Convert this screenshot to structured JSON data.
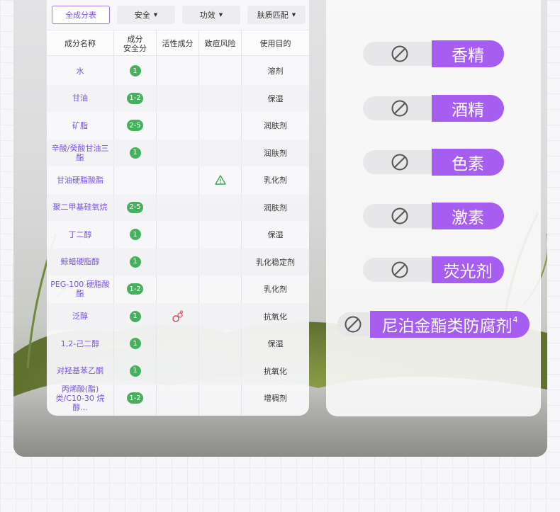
{
  "filters": [
    {
      "label": "全成分表",
      "active": true
    },
    {
      "label": "安全",
      "active": false
    },
    {
      "label": "功效",
      "active": false
    },
    {
      "label": "肤质匹配",
      "active": false
    }
  ],
  "table": {
    "headers": {
      "name": "成分名称",
      "safety_line1": "成分",
      "safety_line2": "安全分",
      "active": "活性成分",
      "acne": "致痘风险",
      "purpose": "使用目的"
    },
    "rows": [
      {
        "name": "水",
        "score": "1",
        "active": "",
        "acne": "",
        "purpose": "溶剂"
      },
      {
        "name": "甘油",
        "score": "1-2",
        "active": "",
        "acne": "",
        "purpose": "保湿"
      },
      {
        "name": "矿脂",
        "score": "2-5",
        "active": "",
        "acne": "",
        "purpose": "润肤剂"
      },
      {
        "name": "辛酸/癸酸甘油三酯",
        "score": "1",
        "active": "",
        "acne": "",
        "purpose": "润肤剂"
      },
      {
        "name": "甘油硬脂酸酯",
        "score": "",
        "active": "",
        "acne": "warning-icon",
        "purpose": "乳化剂"
      },
      {
        "name": "聚二甲基硅氧烷",
        "score": "2-5",
        "active": "",
        "acne": "",
        "purpose": "润肤剂"
      },
      {
        "name": "丁二醇",
        "score": "1",
        "active": "",
        "acne": "",
        "purpose": "保湿"
      },
      {
        "name": "鲸蜡硬脂醇",
        "score": "1",
        "active": "",
        "acne": "",
        "purpose": "乳化稳定剂"
      },
      {
        "name": "PEG-100 硬脂酸酯",
        "score": "1-2",
        "active": "",
        "acne": "",
        "purpose": "乳化剂"
      },
      {
        "name": "泛醇",
        "score": "1",
        "active": "bubble-icon",
        "acne": "",
        "purpose": "抗氧化"
      },
      {
        "name": "1,2-己二醇",
        "score": "1",
        "active": "",
        "acne": "",
        "purpose": "保湿"
      },
      {
        "name": "对羟基苯乙酮",
        "score": "1",
        "active": "",
        "acne": "",
        "purpose": "抗氧化"
      },
      {
        "name": "丙烯酸(酯)类/C10-30 烷醇...",
        "score": "1-2",
        "active": "",
        "acne": "",
        "purpose": "增稠剂"
      }
    ]
  },
  "free_from": [
    {
      "label": "香精",
      "sup": ""
    },
    {
      "label": "酒精",
      "sup": ""
    },
    {
      "label": "色素",
      "sup": ""
    },
    {
      "label": "激素",
      "sup": ""
    },
    {
      "label": "荧光剂",
      "sup": ""
    },
    {
      "label": "尼泊金酯类防腐剂",
      "sup": "4"
    }
  ],
  "colors": {
    "accent": "#a55ef0",
    "score_green": "#45b15d",
    "name_purple": "#7a55d8",
    "warning_green": "#3aa757",
    "bubble_red": "#d94b5e"
  }
}
